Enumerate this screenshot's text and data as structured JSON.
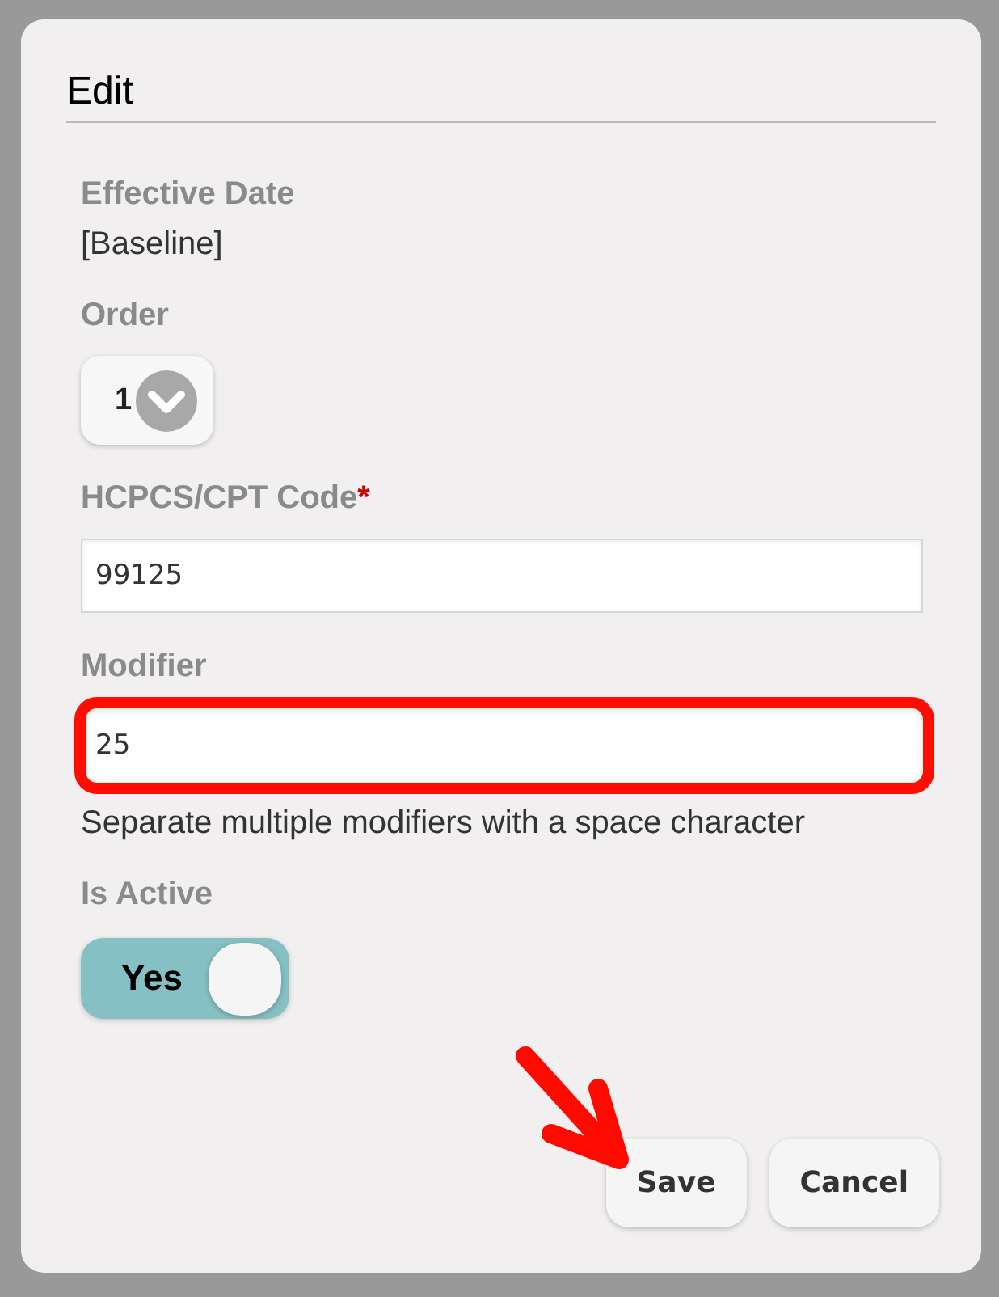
{
  "dialog": {
    "title": "Edit"
  },
  "fields": [
    {
      "kind": "static",
      "label": "Effective Date",
      "value": "[Baseline]"
    },
    {
      "kind": "select",
      "label": "Order",
      "value": "1"
    },
    {
      "kind": "text",
      "label": "HCPCS/CPT Code",
      "required_mark": "*",
      "value": "99125",
      "highlighted": false
    },
    {
      "kind": "text",
      "label": "Modifier",
      "value": "25",
      "highlighted": true,
      "hint": "Separate multiple modifiers with a space character"
    },
    {
      "kind": "toggle",
      "label": "Is Active",
      "on": true,
      "text": "Yes"
    }
  ],
  "buttons": [
    {
      "label": "Save",
      "arrow": true
    },
    {
      "label": "Cancel",
      "arrow": false
    }
  ]
}
